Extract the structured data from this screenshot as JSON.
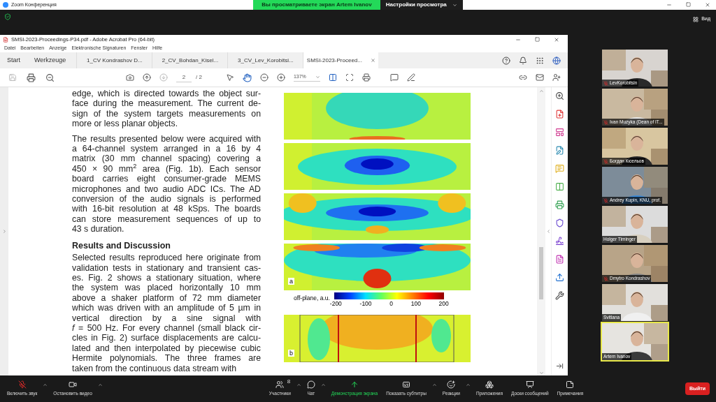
{
  "app": {
    "title": "Zoom Конференция",
    "banner": "Вы просматриваете экран Artem Ivanov",
    "view_settings": "Настройки просмотра",
    "view_button": "Вид"
  },
  "acrobat": {
    "title": "SMSI-2023-Proceedings-P34.pdf - Adobe Acrobat Pro (64-bit)",
    "menu": [
      "Datei",
      "Bearbeiten",
      "Anzeige",
      "Elektronische Signaturen",
      "Fenster",
      "Hilfe"
    ],
    "home_tabs": [
      "Start",
      "Werkzeuge"
    ],
    "tabs": [
      {
        "label": "1_CV Kondrashov D...",
        "selected": false
      },
      {
        "label": "2_CV_Bohdan_Kisel...",
        "selected": false
      },
      {
        "label": "3_CV_Lev_Korobitsi...",
        "selected": false
      },
      {
        "label": "SMSI-2023-Proceed...",
        "selected": true
      }
    ],
    "page": "2",
    "page_total": "/ 2",
    "zoom": "137%",
    "paragraphs": [
      {
        "kind": "body",
        "lines": [
          "edge, which is directed towards the object sur-",
          "face during the measurement. The current de-",
          "sign of the system targets measurements on",
          "more or less planar objects."
        ]
      },
      {
        "kind": "body",
        "lines": [
          "The results presented below were acquired with",
          "a 64-channel system arranged in a 16 by 4",
          "matrix (30 mm channel spacing) covering a",
          "450 × 90 mm$^{2}$  area  (Fig. 1b).  Each  sensor",
          "board carries eight consumer-grade MEMS",
          "microphones and two audio ADC ICs. The AD",
          "conversion of the audio signals is performed",
          "with 16-bit resolution at 48 kSps. The boards",
          "can store measurement sequences of up to",
          "43 s duration."
        ]
      },
      {
        "kind": "heading",
        "lines": [
          "Results and Discussion"
        ]
      },
      {
        "kind": "body",
        "lines": [
          "Selected results reproduced here originate from",
          "validation tests in stationary and transient cas-",
          "es. Fig. 2 shows a stationary situation, where",
          "the system was placed horizontally 10 mm",
          "above a shaker platform of 72 mm diameter",
          "which was driven with an amplitude of 5 µm in",
          "vertical direction by a sine signal with",
          "*f* = 500 Hz. For every channel (small black cir-",
          "cles in Fig. 2) surface displacements are calcu-",
          "lated and then interpolated by piecewise cubic",
          "Hermite polynomials. The three frames are",
          "taken from the continuous data stream with"
        ]
      }
    ],
    "figure": {
      "panel_a_label": "a",
      "colorbar_label": "off-plane, a.u.",
      "colorbar_ticks": [
        "-200",
        "-100",
        "0",
        "100",
        "200"
      ],
      "panel_b_label": "b"
    }
  },
  "participants": [
    {
      "name": "LevKorobitsin",
      "muted": true,
      "active": false
    },
    {
      "name": "Ivan Muzyka (Dean of IT...",
      "muted": true,
      "active": false
    },
    {
      "name": "Богдан Кісельов",
      "muted": true,
      "active": false
    },
    {
      "name": "Andrey Kupin, KNU, prof.",
      "muted": true,
      "active": false
    },
    {
      "name": "Holger Timinger",
      "muted": false,
      "active": false
    },
    {
      "name": "Dmytro Kondrashov",
      "muted": true,
      "active": false
    },
    {
      "name": "Svitlana",
      "muted": false,
      "active": false
    },
    {
      "name": "Artem Ivanov",
      "muted": false,
      "active": true
    }
  ],
  "toolbar": [
    {
      "label": "Включить звук",
      "menu": true,
      "active": false
    },
    {
      "label": "Остановить видео",
      "menu": true,
      "active": false
    },
    {
      "label": "Участники",
      "count": "8",
      "menu": true,
      "active": false
    },
    {
      "label": "Чат",
      "menu": true,
      "active": false
    },
    {
      "label": "Демонстрация экрана",
      "menu": false,
      "active": true
    },
    {
      "label": "Показать субтитры",
      "menu": true,
      "active": false
    },
    {
      "label": "Реакции",
      "menu": true,
      "active": false
    },
    {
      "label": "Приложения",
      "menu": false,
      "active": false
    },
    {
      "label": "Доски сообщений",
      "menu": false,
      "active": false
    },
    {
      "label": "Примечания",
      "menu": false,
      "active": false
    }
  ],
  "leave_button": "Выйти"
}
